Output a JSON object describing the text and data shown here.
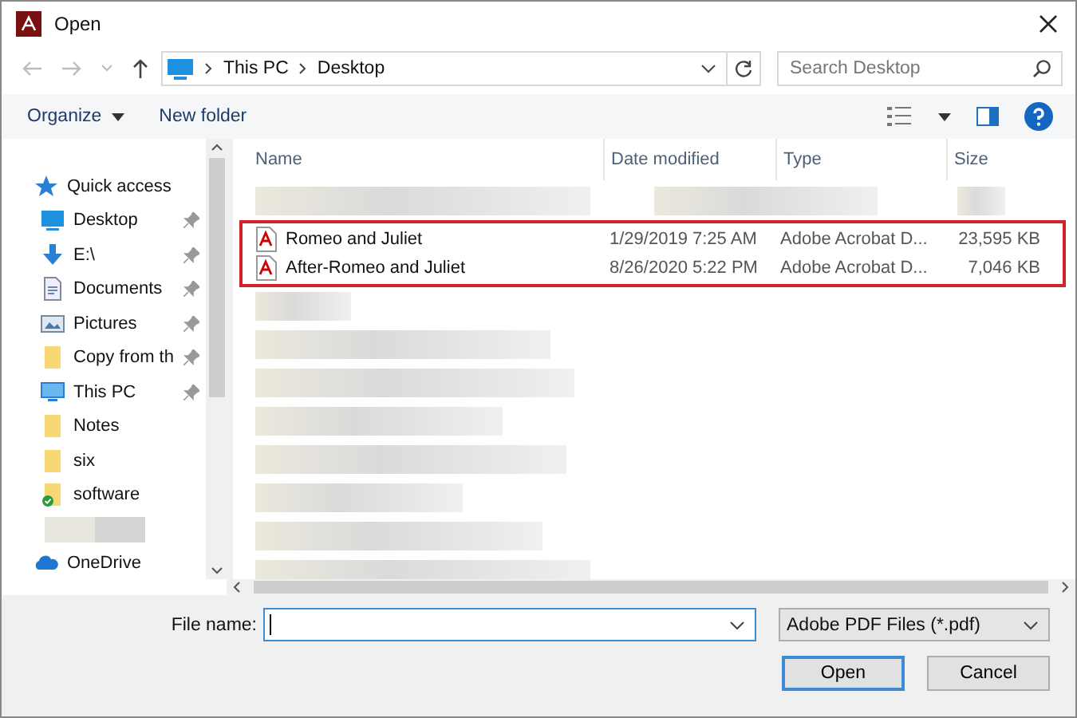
{
  "window": {
    "title": "Open"
  },
  "address": {
    "crumbs": [
      "This PC",
      "Desktop"
    ]
  },
  "search": {
    "placeholder": "Search Desktop"
  },
  "toolbar": {
    "organize": "Organize",
    "new_folder": "New folder"
  },
  "sidebar": {
    "items": [
      {
        "label": "Quick access",
        "kind": "star",
        "children": [
          {
            "label": "Desktop",
            "kind": "desktop",
            "pinned": true
          },
          {
            "label": "E:\\",
            "kind": "download",
            "pinned": true
          },
          {
            "label": "Documents",
            "kind": "document",
            "pinned": true
          },
          {
            "label": "Pictures",
            "kind": "pictures",
            "pinned": true
          },
          {
            "label": "Copy from th",
            "kind": "folder",
            "pinned": true
          },
          {
            "label": "This PC",
            "kind": "pc",
            "pinned": true
          },
          {
            "label": "Notes",
            "kind": "folder",
            "pinned": false
          },
          {
            "label": "six",
            "kind": "folder",
            "pinned": false
          },
          {
            "label": "software",
            "kind": "synced",
            "pinned": false
          },
          {
            "kind": "blurred"
          }
        ]
      },
      {
        "label": "OneDrive",
        "kind": "cloud"
      }
    ]
  },
  "table": {
    "columns": [
      "Name",
      "Date modified",
      "Type",
      "Size"
    ],
    "rows": [
      {
        "kind": "blurred",
        "highlighted": false
      },
      {
        "kind": "file",
        "name": "Romeo and Juliet",
        "date": "1/29/2019 7:25 AM",
        "type": "Adobe Acrobat D...",
        "size": "23,595 KB",
        "highlighted": true
      },
      {
        "kind": "file",
        "name": "After-Romeo and Juliet",
        "date": "8/26/2020 5:22 PM",
        "type": "Adobe Acrobat D...",
        "size": "7,046 KB",
        "highlighted": true
      },
      {
        "kind": "blurred",
        "highlighted": false
      },
      {
        "kind": "blurred",
        "highlighted": false
      },
      {
        "kind": "blurred",
        "highlighted": false
      },
      {
        "kind": "blurred",
        "highlighted": false
      },
      {
        "kind": "blurred",
        "highlighted": false
      },
      {
        "kind": "blurred",
        "highlighted": false
      },
      {
        "kind": "blurred",
        "highlighted": false
      },
      {
        "kind": "blurred",
        "highlighted": false
      }
    ]
  },
  "footer": {
    "file_name_label": "File name:",
    "file_type": "Adobe PDF Files (*.pdf)",
    "buttons": [
      {
        "label": "Open",
        "default": true
      },
      {
        "label": "Cancel",
        "default": false
      }
    ]
  }
}
